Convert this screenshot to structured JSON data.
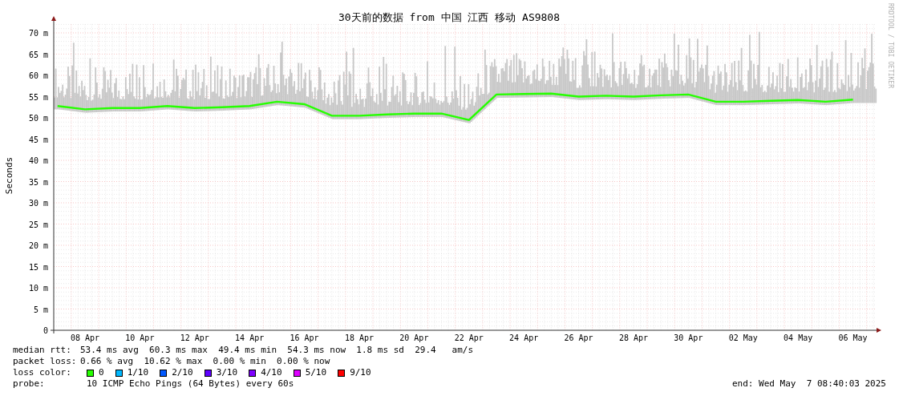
{
  "graph": {
    "title": "30天前的数据 from 中国 江西 移动 AS9808",
    "signature": "RRDTOOL / TOBI OETIKER",
    "chart_data": {
      "type": "line",
      "ylabel": "Seconds",
      "ylim": [
        0,
        72
      ],
      "grid": true,
      "categories": [
        null,
        "08 Apr",
        null,
        "10 Apr",
        null,
        "12 Apr",
        null,
        "14 Apr",
        null,
        "16 Apr",
        null,
        "18 Apr",
        null,
        "20 Apr",
        null,
        "22 Apr",
        null,
        "24 Apr",
        null,
        "26 Apr",
        null,
        "28 Apr",
        null,
        "30 Apr",
        null,
        "02 May",
        null,
        "04 May",
        null,
        "06 May"
      ],
      "series": [
        {
          "color": "#26ff00",
          "values": [
            52.8,
            52.0,
            52.3,
            52.3,
            52.8,
            52.3,
            52.5,
            52.8,
            53.8,
            53.2,
            50.5,
            50.5,
            50.8,
            51.0,
            51.0,
            49.5,
            55.5,
            55.6,
            55.7,
            55.0,
            55.2,
            55.0,
            55.3,
            55.5,
            53.8,
            53.8,
            54.0,
            54.2,
            53.8,
            54.3
          ]
        }
      ],
      "yticks": [
        {
          "value": 0,
          "label": "0"
        },
        {
          "value": 5,
          "label": "5 m"
        },
        {
          "value": 10,
          "label": "10 m"
        },
        {
          "value": 15,
          "label": "15 m"
        },
        {
          "value": 20,
          "label": "20 m"
        },
        {
          "value": 25,
          "label": "25 m"
        },
        {
          "value": 30,
          "label": "30 m"
        },
        {
          "value": 35,
          "label": "35 m"
        },
        {
          "value": 40,
          "label": "40 m"
        },
        {
          "value": 45,
          "label": "45 m"
        },
        {
          "value": 50,
          "label": "50 m"
        },
        {
          "value": 55,
          "label": "55 m"
        },
        {
          "value": 60,
          "label": "60 m"
        },
        {
          "value": 65,
          "label": "65 m"
        },
        {
          "value": 70,
          "label": "70 m"
        }
      ]
    }
  },
  "stats": [
    {
      "label": "median rtt:",
      "value": "53.4 ms avg  60.3 ms max  49.4 ms min  54.3 ms now  1.8 ms sd  29.4   am/s"
    },
    {
      "label": "packet loss:",
      "value": "0.66 % avg  10.62 % max  0.00 % min  0.00 % now"
    }
  ],
  "loss_color": {
    "label": "loss color:",
    "items": [
      {
        "label": "0",
        "color": "#26ff00"
      },
      {
        "label": "1/10",
        "color": "#00b8ff"
      },
      {
        "label": "2/10",
        "color": "#0059ff"
      },
      {
        "label": "3/10",
        "color": "#5e00ff"
      },
      {
        "label": "4/10",
        "color": "#7e00ff"
      },
      {
        "label": "5/10",
        "color": "#dd00ff"
      },
      {
        "label": "9/10",
        "color": "#ff0000"
      }
    ]
  },
  "probe": {
    "label": "probe:",
    "value": "10 ICMP Echo Pings (64 Bytes) every 60s"
  },
  "end": "end: Wed May  7 08:40:03 2025"
}
